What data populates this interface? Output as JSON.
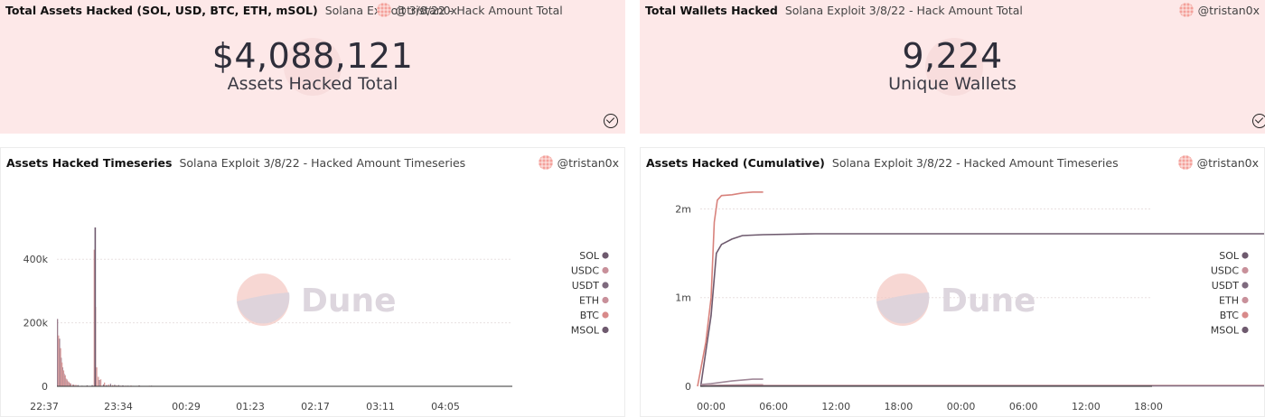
{
  "panels": [
    {
      "title": "Total Assets Hacked (SOL, USD, BTC, ETH, mSOL)",
      "subtitle": "Solana Exploit 3/8/22 - Hack Amount Total",
      "author": "@tristan0x",
      "value": "$4,088,121",
      "label": "Assets Hacked Total"
    },
    {
      "title": "Total Wallets Hacked",
      "subtitle": "Solana Exploit 3/8/22 - Hack Amount Total",
      "author": "@tristan0x",
      "value": "9,224",
      "label": "Unique Wallets"
    },
    {
      "title": "Assets Hacked Timeseries",
      "subtitle": "Solana Exploit 3/8/22 - Hacked Amount Timeseries",
      "author": "@tristan0x"
    },
    {
      "title": "Assets Hacked (Cumulative)",
      "subtitle": "Solana Exploit 3/8/22 - Hacked Amount Timeseries",
      "author": "@tristan0x"
    }
  ],
  "watermark": "Dune",
  "colors": {
    "background": "#fde8e8",
    "accent": "#e6857c",
    "series_dark": "#6e5a6e"
  },
  "icons": {
    "check": "check-circle-icon",
    "avatar": "avatar-icon"
  },
  "chart_data": [
    {
      "type": "bar",
      "x_ticks": [
        "22:37",
        "23:34",
        "00:29",
        "01:23",
        "02:17",
        "03:11",
        "04:05"
      ],
      "y_ticks": [
        "0",
        "200k",
        "400k"
      ],
      "ylim": [
        0,
        500000
      ],
      "legend": [
        "SOL",
        "USDC",
        "USDT",
        "ETH",
        "BTC",
        "MSOL"
      ],
      "legend_colors": [
        "#6e5a6e",
        "#c8909a",
        "#7e6a7e",
        "#c8909a",
        "#d88a8a",
        "#6e5a6e"
      ],
      "legend_position": "right",
      "grid": true,
      "series": [
        {
          "name": "SOL",
          "values": [
            [
              0.0,
              212000
            ],
            [
              0.1,
              150000
            ],
            [
              0.18,
              90000
            ],
            [
              0.25,
              60000
            ],
            [
              0.32,
              40000
            ],
            [
              0.4,
              25000
            ],
            [
              0.48,
              18000
            ],
            [
              0.56,
              12000
            ],
            [
              0.65,
              8000
            ],
            [
              0.8,
              5000
            ],
            [
              1.0,
              4000
            ],
            [
              1.2,
              2000
            ],
            [
              1.45,
              3000
            ],
            [
              1.7,
              4000
            ],
            [
              1.85,
              2000
            ],
            [
              2.05,
              20000
            ],
            [
              2.25,
              6000
            ],
            [
              2.4,
              4000
            ],
            [
              2.6,
              8000
            ],
            [
              2.8,
              5000
            ],
            [
              3.0,
              4000
            ],
            [
              3.2,
              3000
            ],
            [
              3.45,
              2000
            ],
            [
              3.7,
              1500
            ],
            [
              4.0,
              3000
            ],
            [
              4.3,
              1000
            ],
            [
              4.6,
              2000
            ],
            [
              5.0,
              1000
            ],
            [
              5.5,
              800
            ],
            [
              6.0,
              600
            ],
            [
              7.0,
              400
            ],
            [
              8.0,
              300
            ],
            [
              9.1,
              200
            ],
            [
              10.2,
              150
            ],
            [
              11.4,
              100
            ],
            [
              12.7,
              100
            ],
            [
              13.9,
              100
            ],
            [
              15.0,
              100
            ],
            [
              16.2,
              100
            ],
            [
              17.4,
              100
            ],
            [
              18.6,
              50
            ]
          ]
        },
        {
          "name": "USDC",
          "values": [
            [
              0.05,
              160000
            ],
            [
              0.15,
              120000
            ],
            [
              0.22,
              75000
            ],
            [
              0.3,
              50000
            ],
            [
              0.38,
              35000
            ],
            [
              0.46,
              22000
            ],
            [
              0.54,
              15000
            ],
            [
              0.62,
              10000
            ],
            [
              0.75,
              6000
            ],
            [
              0.9,
              5000
            ],
            [
              1.8,
              430000
            ],
            [
              1.86,
              250000
            ],
            [
              1.92,
              60000
            ],
            [
              2.0,
              30000
            ],
            [
              2.12,
              22000
            ],
            [
              2.3,
              12000
            ],
            [
              2.5,
              6000
            ],
            [
              2.7,
              4000
            ],
            [
              2.9,
              3000
            ],
            [
              3.1,
              2000
            ],
            [
              3.35,
              2000
            ],
            [
              3.6,
              2500
            ],
            [
              3.9,
              1500
            ],
            [
              4.2,
              1200
            ],
            [
              4.5,
              1800
            ],
            [
              4.8,
              1000
            ],
            [
              5.2,
              700
            ],
            [
              5.7,
              500
            ],
            [
              6.3,
              400
            ]
          ]
        },
        {
          "name": "MSOL",
          "values": [
            [
              1.84,
              500000
            ]
          ]
        }
      ]
    },
    {
      "type": "line",
      "x_ticks": [
        "00:00",
        "06:00",
        "12:00",
        "18:00",
        "00:00",
        "06:00",
        "12:00",
        "18:00"
      ],
      "y_ticks": [
        "0",
        "1m",
        "2m"
      ],
      "ylim": [
        0,
        2300000
      ],
      "legend": [
        "SOL",
        "USDC",
        "USDT",
        "ETH",
        "BTC",
        "MSOL"
      ],
      "legend_colors": [
        "#6e5a6e",
        "#c8909a",
        "#7e6a7e",
        "#c8909a",
        "#d88a8a",
        "#6e5a6e"
      ],
      "legend_position": "right",
      "grid": true,
      "series": [
        {
          "name": "SOL",
          "values": [
            [
              -1,
              0
            ],
            [
              0,
              800000
            ],
            [
              0.5,
              1500000
            ],
            [
              1,
              1600000
            ],
            [
              2,
              1660000
            ],
            [
              3,
              1700000
            ],
            [
              5,
              1710000
            ],
            [
              10,
              1720000
            ],
            [
              20,
              1720000
            ],
            [
              30,
              1720000
            ],
            [
              40,
              1720000
            ],
            [
              48,
              1720000
            ],
            [
              56,
              1720000
            ]
          ]
        },
        {
          "name": "USDC",
          "values": [
            [
              -1.3,
              0
            ],
            [
              -0.5,
              500000
            ],
            [
              0,
              1000000
            ],
            [
              0.3,
              1850000
            ],
            [
              0.6,
              2100000
            ],
            [
              1,
              2150000
            ],
            [
              2,
              2160000
            ],
            [
              3,
              2180000
            ],
            [
              4,
              2190000
            ],
            [
              5,
              2190000
            ]
          ]
        },
        {
          "name": "USDT",
          "values": [
            [
              -1,
              20000
            ],
            [
              0,
              30000
            ],
            [
              2,
              60000
            ],
            [
              4,
              80000
            ],
            [
              5,
              80000
            ]
          ]
        },
        {
          "name": "ETH",
          "values": [
            [
              -1,
              5000
            ],
            [
              0,
              10000
            ],
            [
              2,
              15000
            ],
            [
              4,
              18000
            ],
            [
              5,
              18000
            ]
          ]
        },
        {
          "name": "BTC",
          "values": [
            [
              -1,
              3000
            ],
            [
              0,
              6000
            ],
            [
              5,
              8000
            ],
            [
              56,
              8000
            ]
          ]
        },
        {
          "name": "MSOL",
          "values": [
            [
              -1,
              2000
            ],
            [
              0,
              4000
            ],
            [
              5,
              5000
            ],
            [
              56,
              5000
            ]
          ]
        }
      ]
    }
  ]
}
